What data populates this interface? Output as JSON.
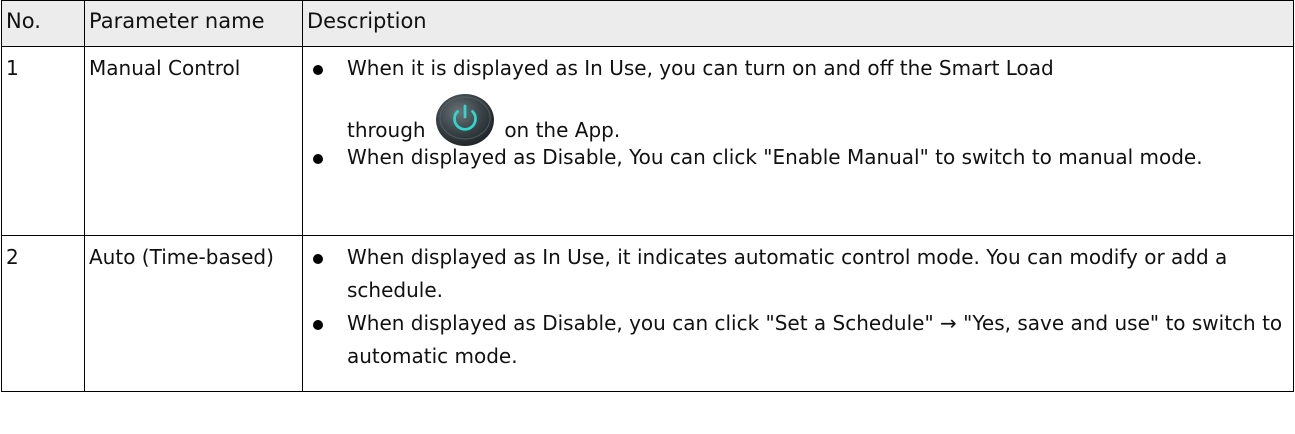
{
  "table": {
    "headers": {
      "no": "No.",
      "name": "Parameter name",
      "description": "Description"
    },
    "rows": [
      {
        "no": "1",
        "name": "Manual Control",
        "bullet1_part1": "When it is displayed as In Use, you can turn on and off the Smart Load",
        "bullet1_before_icon": "through",
        "bullet1_after_icon": "on the App.",
        "bullet1_icon": "power-button-icon",
        "bullet2": "When displayed as Disable, You can click \"Enable Manual\" to switch to manual mode."
      },
      {
        "no": "2",
        "name": "Auto (Time-based)",
        "bullet1": "When displayed as In Use, it indicates automatic control mode. You can modify or add a schedule.",
        "bullet2": "When displayed as Disable, you can click \"Set a Schedule\" → \"Yes, save and use\" to switch to automatic mode."
      }
    ]
  }
}
